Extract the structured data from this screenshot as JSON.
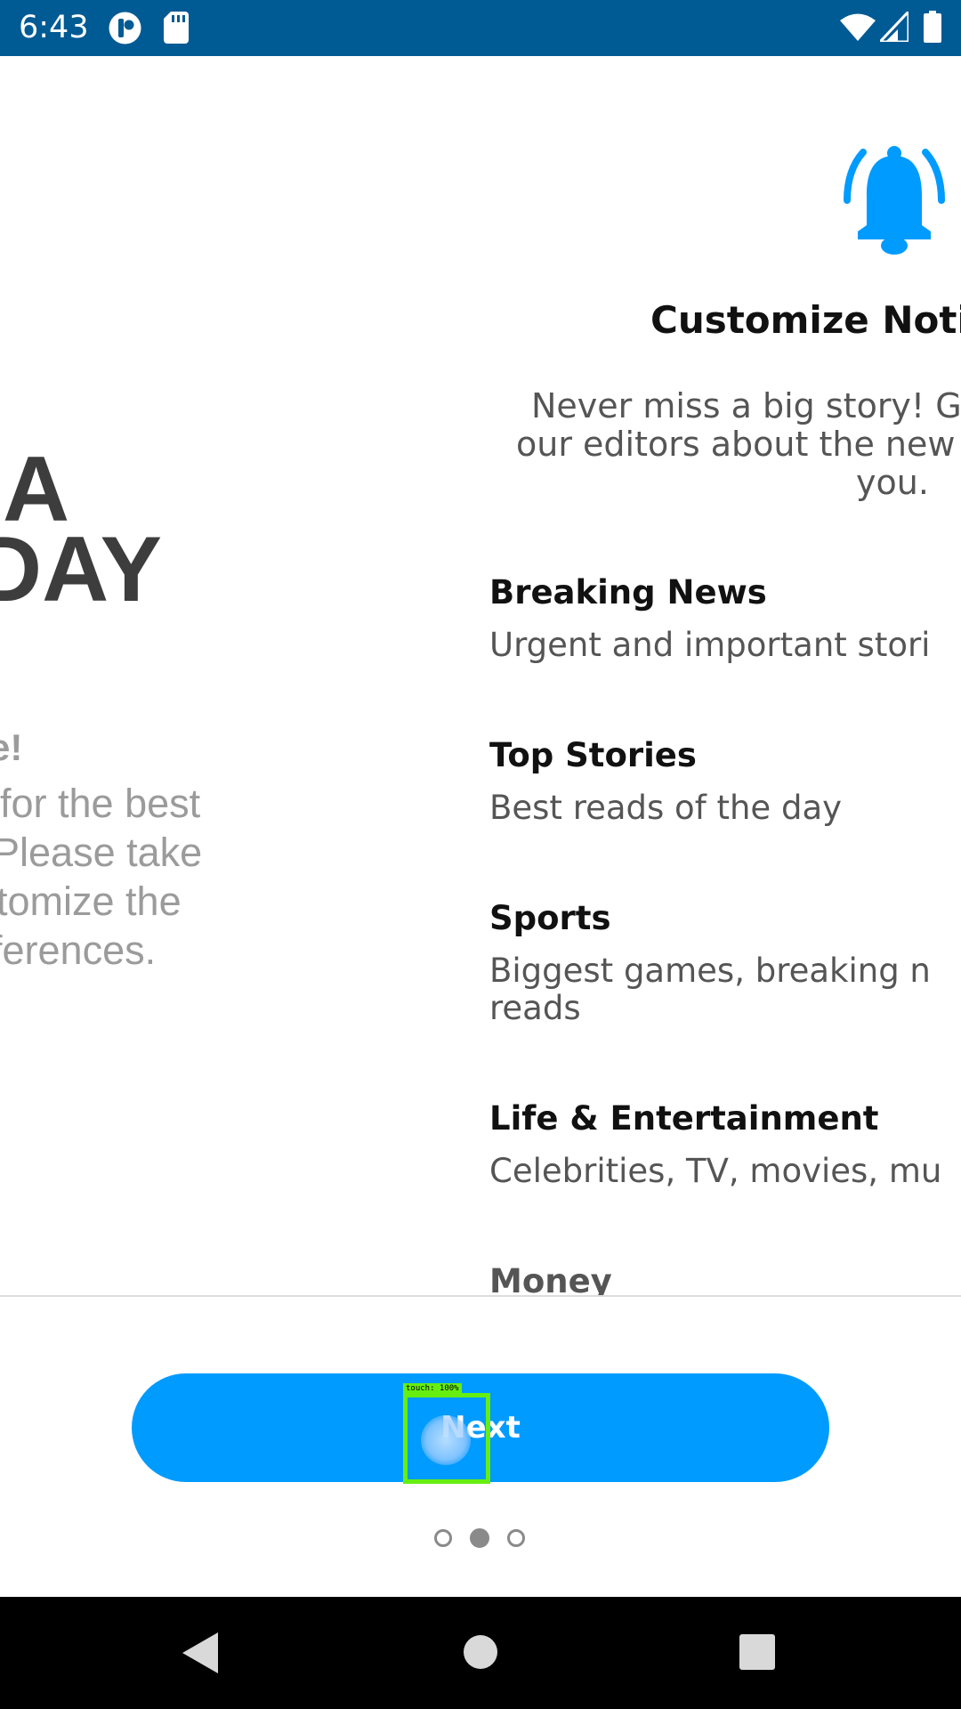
{
  "status_bar": {
    "time": "6:43",
    "icons": [
      "assistant-icon",
      "sd-card-icon",
      "wifi-icon",
      "signal-icon",
      "battery-icon"
    ]
  },
  "welcome_page": {
    "brand_lines": [
      "A",
      "DAY"
    ],
    "heading": "e!",
    "body_lines": [
      " for the best",
      "Please take",
      "tomize the",
      "ferences."
    ]
  },
  "notifications_page": {
    "icon": "bell-icon",
    "title": "Customize Noti",
    "description_lines": [
      "Never miss a big story! G",
      "our editors about the new",
      "you."
    ],
    "options": [
      {
        "title": "Breaking News",
        "description": [
          "Urgent and important stori"
        ]
      },
      {
        "title": "Top Stories",
        "description": [
          "Best reads of the day"
        ]
      },
      {
        "title": "Sports",
        "description": [
          "Biggest games, breaking n",
          "reads"
        ]
      },
      {
        "title": "Life & Entertainment",
        "description": [
          "Celebrities, TV, movies, mu"
        ]
      },
      {
        "title": "Money",
        "description": []
      }
    ]
  },
  "footer": {
    "next_label": "Next",
    "touch_overlay_label": "touch: 100%",
    "pager": {
      "count": 3,
      "active_index": 1
    }
  },
  "nav_bar": {
    "buttons": [
      "back-icon",
      "home-icon",
      "recents-icon"
    ]
  },
  "colors": {
    "status_bar": "#005a94",
    "accent": "#009bff",
    "touch_overlay": "#66ee11"
  }
}
